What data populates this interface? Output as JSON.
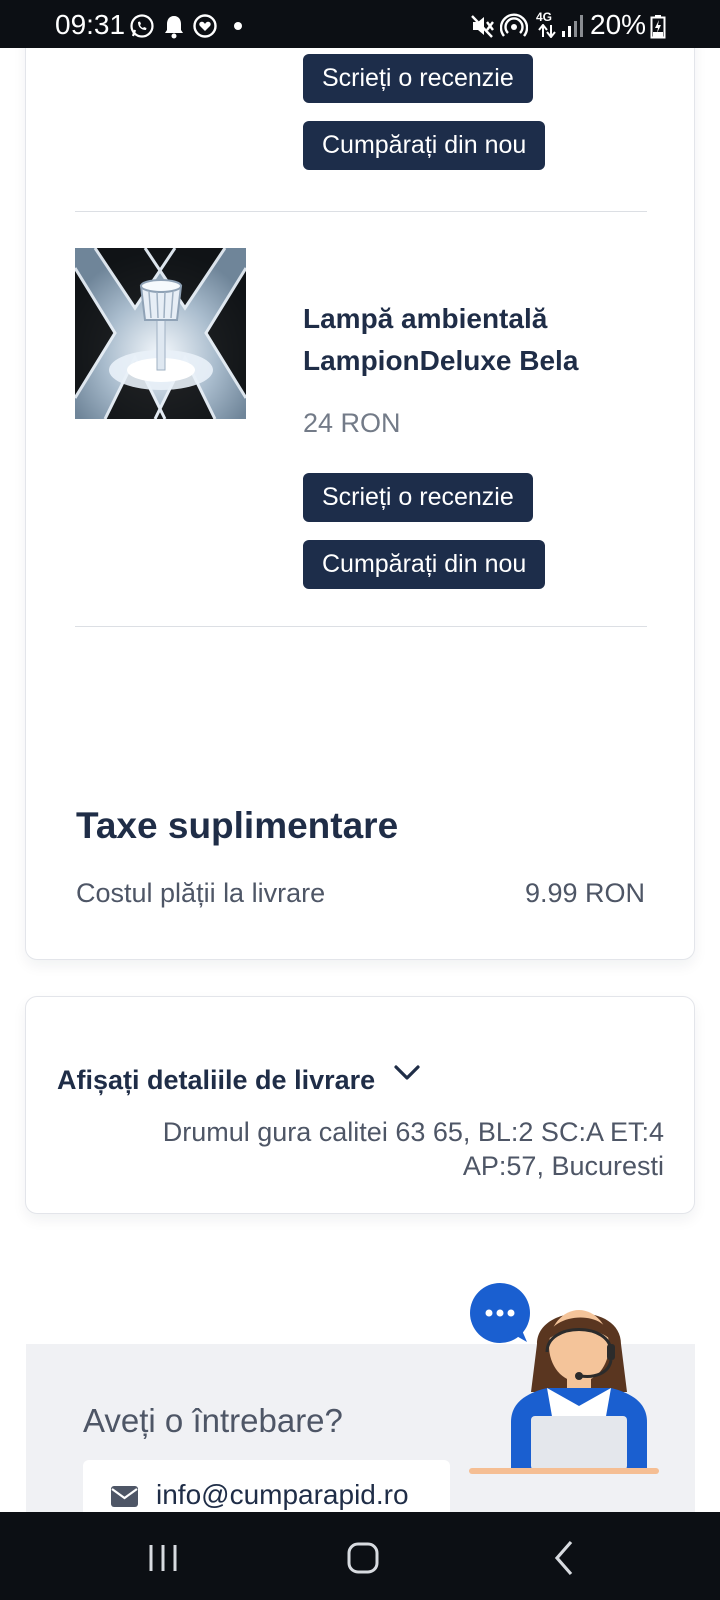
{
  "status_bar": {
    "time": "09:31",
    "battery": "20%",
    "network": "4G",
    "left_icons": [
      "whatsapp-icon",
      "bell-icon",
      "heart-monitor-icon",
      "dot-icon"
    ],
    "right_icons": [
      "mute-icon",
      "hotspot-icon",
      "4g-icon",
      "signal-icon",
      "battery-icon"
    ]
  },
  "order": {
    "products": [
      {
        "name": "",
        "price": "",
        "review_label": "Scrieți o recenzie",
        "buy_again_label": "Cumpărați din nou"
      },
      {
        "name": "Lampă ambientală LampionDeluxe Bela",
        "price": "24 RON",
        "review_label": "Scrieți o recenzie",
        "buy_again_label": "Cumpărați din nou"
      }
    ],
    "fees": {
      "title": "Taxe suplimentare",
      "items": [
        {
          "label": "Costul plății la livrare",
          "value": "9.99 RON"
        }
      ]
    }
  },
  "delivery": {
    "toggle_label": "Afișați detaliile de livrare",
    "address": "Drumul gura calitei 63 65, BL:2 SC:A ET:4 AP:57, Bucuresti"
  },
  "help": {
    "title": "Aveți o întrebare?",
    "email": "info@cumparapid.ro"
  },
  "colors": {
    "button_bg": "#1d2d4a",
    "heading": "#1f2d47",
    "muted_text": "#737b88",
    "chat_bubble": "#1a5fd0"
  },
  "nav_icons": [
    "recent-apps-icon",
    "home-icon",
    "back-icon"
  ]
}
